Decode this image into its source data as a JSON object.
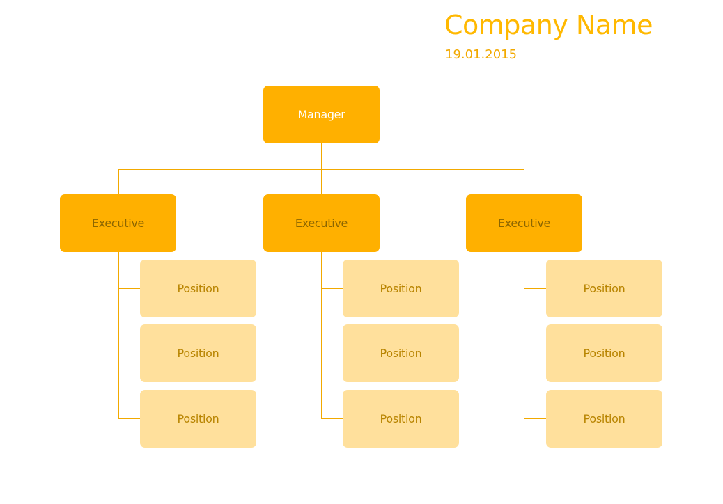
{
  "header": {
    "company_name": "Company Name",
    "date": "19.01.2015"
  },
  "colors": {
    "accent": "#FFB800",
    "node_primary": "#FFB000",
    "node_secondary": "#FFE09C",
    "connector": "#F2A900"
  },
  "org_chart": {
    "manager": {
      "label": "Manager"
    },
    "executives": [
      {
        "label": "Executive",
        "positions": [
          {
            "label": "Position"
          },
          {
            "label": "Position"
          },
          {
            "label": "Position"
          }
        ]
      },
      {
        "label": "Executive",
        "positions": [
          {
            "label": "Position"
          },
          {
            "label": "Position"
          },
          {
            "label": "Position"
          }
        ]
      },
      {
        "label": "Executive",
        "positions": [
          {
            "label": "Position"
          },
          {
            "label": "Position"
          },
          {
            "label": "Position"
          }
        ]
      }
    ]
  }
}
